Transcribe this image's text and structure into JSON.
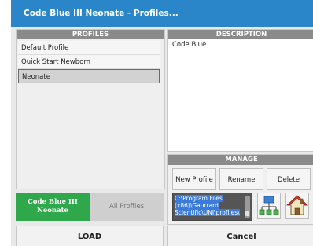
{
  "window": {
    "title": "Code Blue III Neonate - Profiles..."
  },
  "profiles": {
    "header": "PROFILES",
    "items": [
      {
        "label": "Default Profile"
      },
      {
        "label": "Quick Start Newborn"
      },
      {
        "label": "Neonate",
        "selected": true
      }
    ]
  },
  "description": {
    "header": "DESCRIPTION",
    "text": "Code Blue"
  },
  "manage": {
    "header": "MANAGE",
    "new_label": "New Profile",
    "rename_label": "Rename",
    "delete_label": "Delete",
    "path_line1": "C:\\Program Files",
    "path_line2": "(x86)\\Gaurrard",
    "path_line3": "Scientific\\UNI\\profiles\\",
    "icons": [
      "network-icon",
      "home-icon"
    ]
  },
  "tabs": {
    "active_line1": "Code Blue III",
    "active_line2": "Neonate",
    "inactive_label": "All Profiles"
  },
  "actions": {
    "load_label": "LOAD",
    "cancel_label": "Cancel"
  },
  "colors": {
    "titlebar": "#2a86c8",
    "active_tab": "#2ea84a",
    "header": "#8a8a8a",
    "selection": "#3a7ad8"
  }
}
